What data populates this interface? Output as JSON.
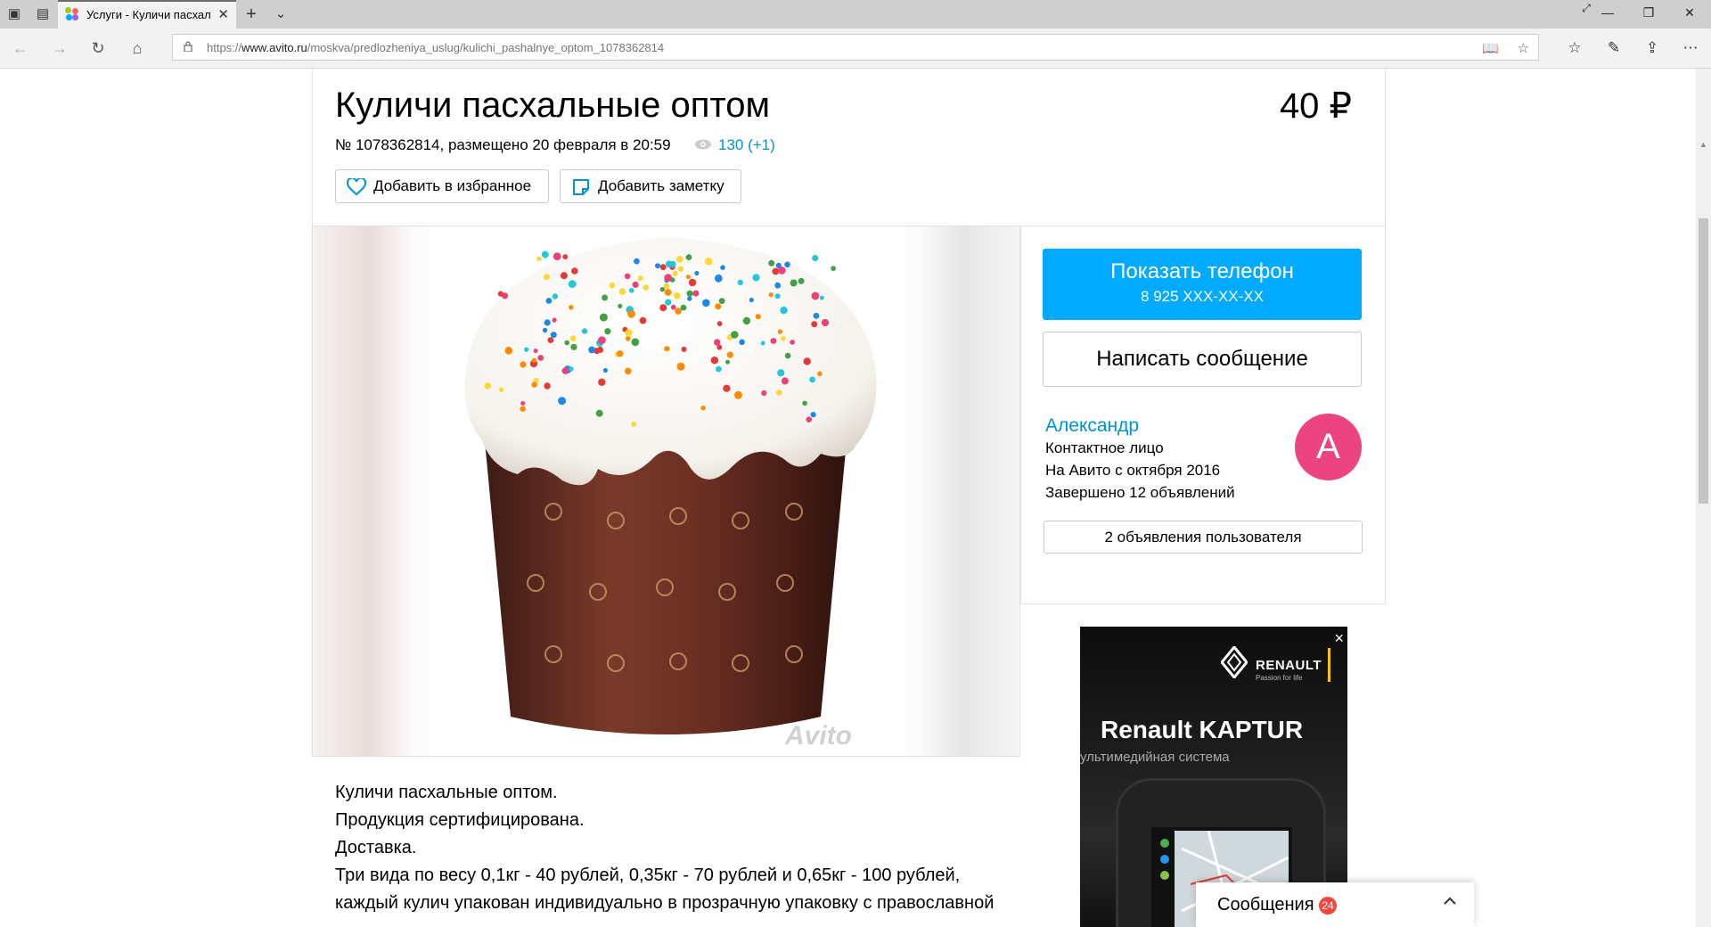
{
  "browser": {
    "tab_title": "Услуги - Куличи пасхал",
    "url_prefix": "https://",
    "url_domain": "www.avito.ru",
    "url_path": "/moskva/predlozheniya_uslug/kulichi_pashalnye_optom_1078362814"
  },
  "listing": {
    "title": "Куличи пасхальные оптом",
    "price": "40 ₽",
    "meta": "№ 1078362814, размещено 20 февраля в 20:59",
    "views": "130 (+1)",
    "favorite_label": "Добавить в избранное",
    "note_label": "Добавить заметку",
    "watermark": "Avito"
  },
  "contact": {
    "show_phone_label": "Показать телефон",
    "phone_masked": "8 925 XXX-XX-XX",
    "write_message_label": "Написать сообщение",
    "seller_name": "Александр",
    "seller_role": "Контактное лицо",
    "seller_since": "На Авито с октября 2016",
    "seller_completed": "Завершено 12 объявлений",
    "avatar_letter": "A",
    "user_ads_label": "2 объявления пользователя"
  },
  "banner": {
    "close": "×",
    "brand": "RENAULT",
    "brand_tagline": "Passion for life",
    "title": "Renault KAPTUR",
    "subtitle": "ультимедийная система"
  },
  "description": {
    "lines": [
      "Куличи пасхальные оптом.",
      "Продукция сертифицирована.",
      "Доставка.",
      "Три вида по весу 0,1кг - 40 рублей, 0,35кг - 70 рублей и 0,65кг - 100 рублей,",
      "каждый кулич упакован индивидуально в прозрачную упаковку с православной"
    ]
  },
  "messages": {
    "label": "Сообщения",
    "count": "24"
  },
  "colors": {
    "accent_blue": "#00aaff",
    "link_blue": "#0091d9",
    "avatar_pink": "#ec4381",
    "badge_red": "#f2463f"
  }
}
